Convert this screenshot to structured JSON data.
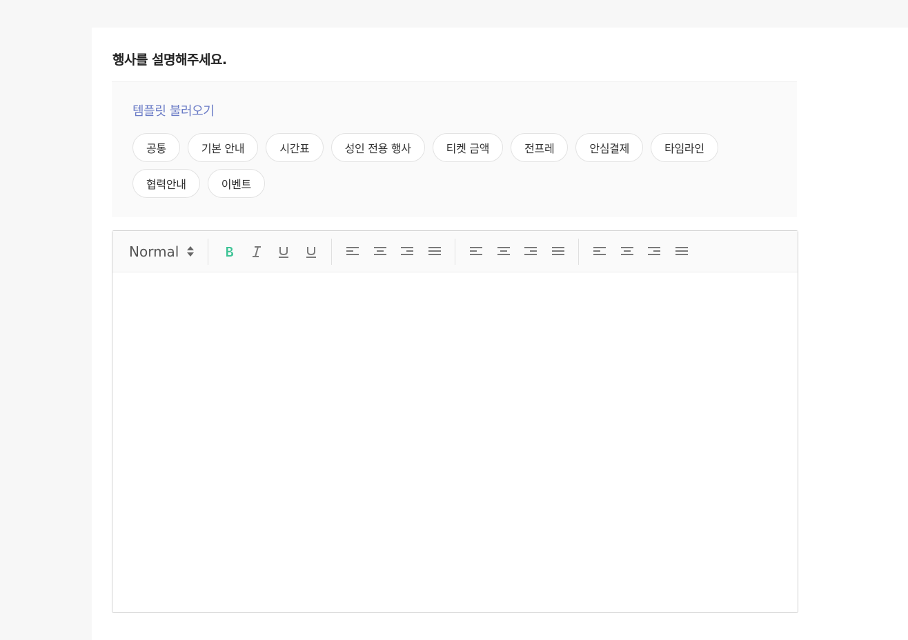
{
  "section": {
    "title": "행사를 설명해주세요."
  },
  "templates": {
    "title": "템플릿 불러오기",
    "chips": [
      "공통",
      "기본 안내",
      "시간표",
      "성인 전용 행사",
      "티켓 금액",
      "전프레",
      "안심결제",
      "타임라인",
      "협력안내",
      "이벤트"
    ]
  },
  "editor": {
    "size_label": "Normal",
    "active_color": "#3cc395",
    "icon_color": "#7a7a7a",
    "content": ""
  }
}
